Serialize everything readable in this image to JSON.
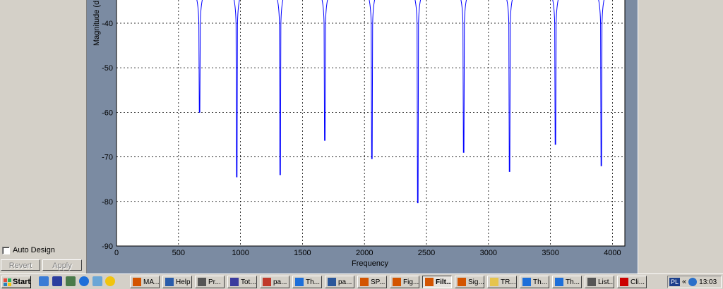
{
  "left_panel": {
    "auto_design_label": "Auto Design",
    "revert_label": "Revert",
    "apply_label": "Apply"
  },
  "chart_data": {
    "type": "line",
    "xlabel": "Frequency",
    "ylabel": "Magnitude (dB",
    "xlim": [
      0,
      4100
    ],
    "ylim": [
      -90,
      -34
    ],
    "x_ticks": [
      0,
      500,
      1000,
      1500,
      2000,
      2500,
      3000,
      3500,
      4000
    ],
    "y_ticks": [
      -40,
      -50,
      -60,
      -70,
      -80,
      -90
    ],
    "grid": true,
    "series_color": "#0000ff",
    "notches": [
      {
        "freq": 670,
        "depth": -60
      },
      {
        "freq": 970,
        "depth": -74.5
      },
      {
        "freq": 1320,
        "depth": -74
      },
      {
        "freq": 1680,
        "depth": -66.3
      },
      {
        "freq": 2060,
        "depth": -70.4
      },
      {
        "freq": 2430,
        "depth": -80.3
      },
      {
        "freq": 2800,
        "depth": -69
      },
      {
        "freq": 3170,
        "depth": -73.3
      },
      {
        "freq": 3540,
        "depth": -67.2
      },
      {
        "freq": 3910,
        "depth": -72
      }
    ]
  },
  "taskbar": {
    "start_label": "Start",
    "tasks": [
      {
        "label": "MA...",
        "icon": "matlab-icon",
        "color": "#d35400"
      },
      {
        "label": "Help",
        "icon": "help-window-icon",
        "color": "#2a5caa"
      },
      {
        "label": "Pr...",
        "icon": "document-icon",
        "color": "#555555"
      },
      {
        "label": "Tot...",
        "icon": "floppy-disk-icon",
        "color": "#3b3b9e"
      },
      {
        "label": "pa...",
        "icon": "pdf-icon",
        "color": "#c0392b"
      },
      {
        "label": "Th...",
        "icon": "ie-browser-icon",
        "color": "#1e6fd9"
      },
      {
        "label": "pa...",
        "icon": "word-document-icon",
        "color": "#2b579a"
      },
      {
        "label": "SP...",
        "icon": "matlab-icon",
        "color": "#d35400"
      },
      {
        "label": "Fig...",
        "icon": "matlab-icon",
        "color": "#d35400"
      },
      {
        "label": "Filt...",
        "icon": "matlab-icon",
        "color": "#d35400"
      },
      {
        "label": "Sig...",
        "icon": "matlab-icon",
        "color": "#d35400"
      },
      {
        "label": "TR...",
        "icon": "folder-icon",
        "color": "#e6c44d"
      },
      {
        "label": "Th...",
        "icon": "ie-browser-icon",
        "color": "#1e6fd9"
      },
      {
        "label": "Th...",
        "icon": "ie-browser-icon",
        "color": "#1e6fd9"
      },
      {
        "label": "List...",
        "icon": "list-document-icon",
        "color": "#555555"
      },
      {
        "label": "Cli...",
        "icon": "clipboard-star-icon",
        "color": "#cc0000"
      }
    ],
    "active_task_index": 9,
    "tray": {
      "language": "PL",
      "chevron": "«",
      "clock": "13:03"
    }
  }
}
